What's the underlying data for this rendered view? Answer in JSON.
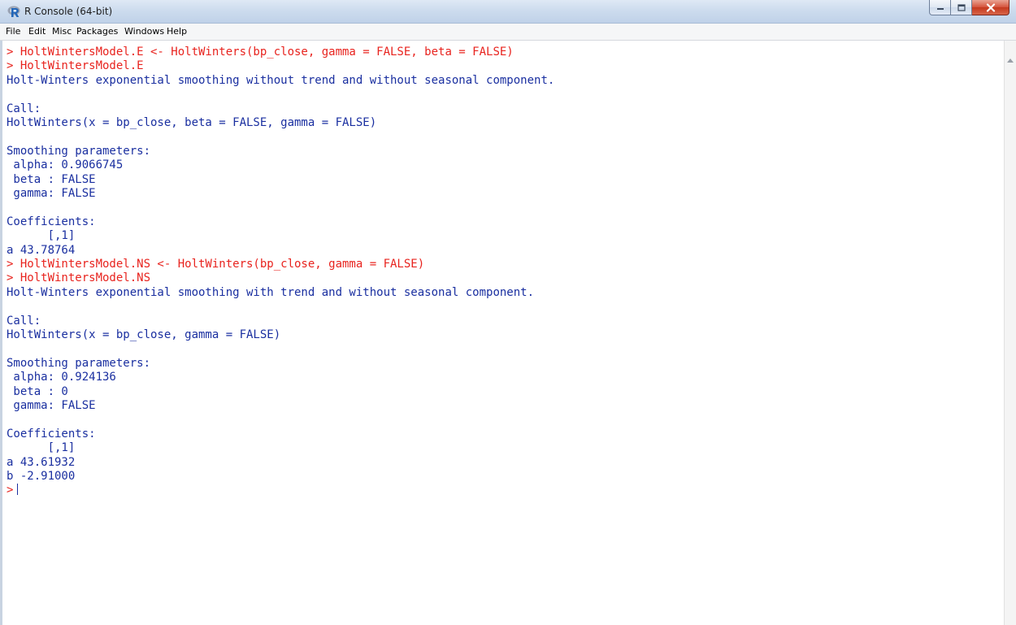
{
  "window": {
    "title": "R Console (64-bit)"
  },
  "menu": [
    "File",
    "Edit",
    "Misc",
    "Packages",
    "Windows",
    "Help"
  ],
  "console": {
    "lines": [
      {
        "type": "cmd",
        "text": "> HoltWintersModel.E <- HoltWinters(bp_close, gamma = FALSE, beta = FALSE)"
      },
      {
        "type": "cmd",
        "text": "> HoltWintersModel.E"
      },
      {
        "type": "out",
        "text": "Holt-Winters exponential smoothing without trend and without seasonal component."
      },
      {
        "type": "out",
        "text": ""
      },
      {
        "type": "out",
        "text": "Call:"
      },
      {
        "type": "out",
        "text": "HoltWinters(x = bp_close, beta = FALSE, gamma = FALSE)"
      },
      {
        "type": "out",
        "text": ""
      },
      {
        "type": "out",
        "text": "Smoothing parameters:"
      },
      {
        "type": "out",
        "text": " alpha: 0.9066745"
      },
      {
        "type": "out",
        "text": " beta : FALSE"
      },
      {
        "type": "out",
        "text": " gamma: FALSE"
      },
      {
        "type": "out",
        "text": ""
      },
      {
        "type": "out",
        "text": "Coefficients:"
      },
      {
        "type": "out",
        "text": "      [,1]"
      },
      {
        "type": "out",
        "text": "a 43.78764"
      },
      {
        "type": "cmd",
        "text": "> HoltWintersModel.NS <- HoltWinters(bp_close, gamma = FALSE)"
      },
      {
        "type": "cmd",
        "text": "> HoltWintersModel.NS"
      },
      {
        "type": "out",
        "text": "Holt-Winters exponential smoothing with trend and without seasonal component."
      },
      {
        "type": "out",
        "text": ""
      },
      {
        "type": "out",
        "text": "Call:"
      },
      {
        "type": "out",
        "text": "HoltWinters(x = bp_close, gamma = FALSE)"
      },
      {
        "type": "out",
        "text": ""
      },
      {
        "type": "out",
        "text": "Smoothing parameters:"
      },
      {
        "type": "out",
        "text": " alpha: 0.924136"
      },
      {
        "type": "out",
        "text": " beta : 0"
      },
      {
        "type": "out",
        "text": " gamma: FALSE"
      },
      {
        "type": "out",
        "text": ""
      },
      {
        "type": "out",
        "text": "Coefficients:"
      },
      {
        "type": "out",
        "text": "      [,1]"
      },
      {
        "type": "out",
        "text": "a 43.61932"
      },
      {
        "type": "out",
        "text": "b -2.91000"
      }
    ],
    "prompt": ">"
  },
  "colors": {
    "command": "#e8231e",
    "output": "#1a2fa0"
  },
  "icons": [
    "r-logo-icon",
    "minimize-icon",
    "maximize-icon",
    "close-icon",
    "scroll-up-arrow-icon"
  ]
}
